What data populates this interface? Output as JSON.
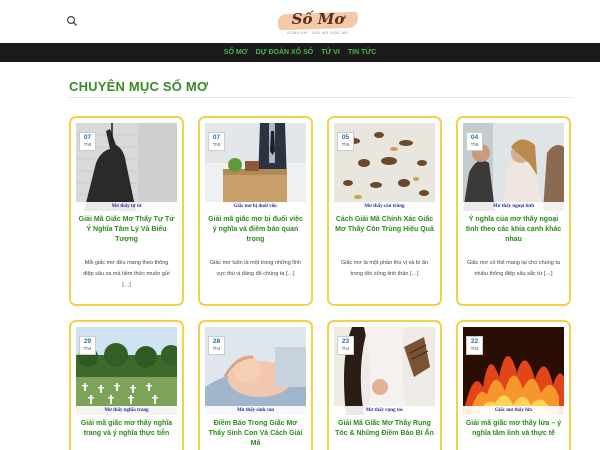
{
  "site": {
    "logo_text": "Số Mơ",
    "logo_tagline": "SOMO.VN · GIẢI MÃ GIẤC MƠ"
  },
  "nav": {
    "items": [
      "SỐ MƠ",
      "DỰ ĐOÁN XỔ SỐ",
      "TỬ VI",
      "TIN TỨC"
    ]
  },
  "page": {
    "title": "CHUYÊN MỤC SỐ MƠ"
  },
  "colors": {
    "accent": "#3a8a22",
    "card_border": "#f0d34a",
    "nav_bg": "#1b1b1b",
    "nav_text": "#48b948"
  },
  "cards": [
    {
      "day": "07",
      "month": "Th5",
      "caption": "Mơ thấy tự tử",
      "title": "Giải Mã Giấc Mơ Thấy Tự Tử Ý Nghĩa Tâm Lý Và Biểu Tượng",
      "excerpt": "Mỗi giấc mơ đều mang theo thông điệp sâu xa mà tiềm thức muốn gửi […]"
    },
    {
      "day": "07",
      "month": "Th5",
      "caption": "Giấc mơ bị đuổi việc",
      "title": "Giải mã giấc mơ bị đuổi việc ý nghĩa và điềm báo quan trọng",
      "excerpt": "Giấc mơ luôn là một trong những lĩnh vực thú vị đáng để chúng ta […]"
    },
    {
      "day": "05",
      "month": "Th5",
      "caption": "Mơ thấy côn trùng",
      "title": "Cách Giải Mã Chính Xác Giấc Mơ Thấy Côn Trùng Hiệu Quả",
      "excerpt": "Giấc mơ là một phần thú vị và bí ẩn trong đời sống tinh thần […]"
    },
    {
      "day": "04",
      "month": "Th5",
      "caption": "Mơ thấy ngoại tình",
      "title": "Ý nghĩa của mơ thấy ngoại tình theo các khía cạnh khác nhau",
      "excerpt": "Giấc mơ có thể mang lại cho chúng ta nhiều thông điệp sâu sắc từ […]"
    },
    {
      "day": "29",
      "month": "Th4",
      "caption": "Mơ thấy nghĩa trang",
      "title": "Giải mã giấc mơ thấy nghĩa trang và ý nghĩa thực tiễn",
      "excerpt": ""
    },
    {
      "day": "28",
      "month": "Th4",
      "caption": "Mơ thấy sinh con",
      "title": "Điềm Báo Trong Giấc Mơ Thấy Sinh Con Và Cách Giải Mã",
      "excerpt": ""
    },
    {
      "day": "23",
      "month": "Th4",
      "caption": "Mơ thấy rụng tóc",
      "title": "Giải Mã Giấc Mơ Thấy Rụng Tóc & Những Điềm Báo Bí Ẩn",
      "excerpt": ""
    },
    {
      "day": "22",
      "month": "Th4",
      "caption": "Giấc mơ thấy lửa",
      "title": "Giải mã giấc mơ thấy lửa – ý nghĩa tâm linh và thực tế",
      "excerpt": ""
    }
  ]
}
